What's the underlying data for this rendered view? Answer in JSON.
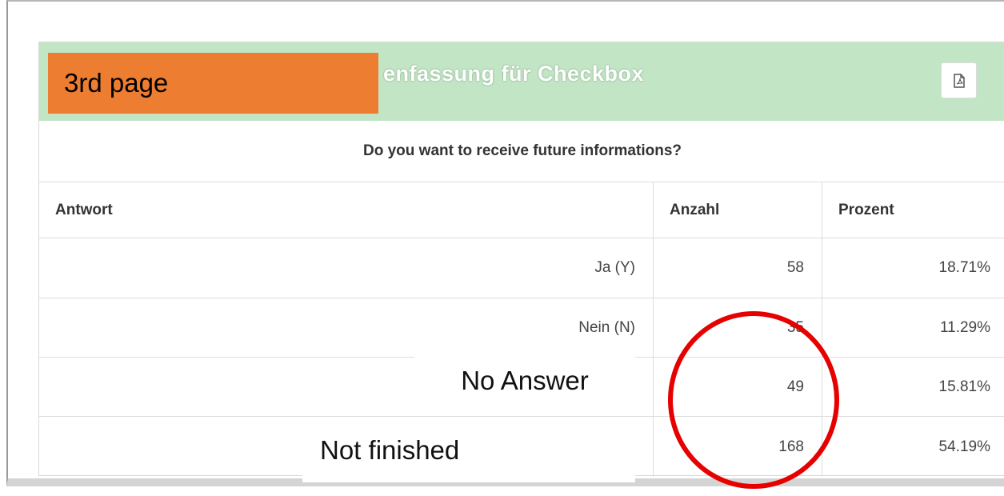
{
  "panel": {
    "title": "enfassung für Checkbox",
    "pdf_icon": "pdf-file-icon",
    "question": "Do you want to receive future informations?"
  },
  "table": {
    "headers": [
      "Antwort",
      "Anzahl",
      "Prozent"
    ],
    "rows": [
      {
        "answer": "Ja (Y)",
        "count": "58",
        "percent": "18.71%"
      },
      {
        "answer": "Nein (N)",
        "count": "35",
        "percent": "11.29%"
      },
      {
        "answer": "",
        "count": "49",
        "percent": "15.81%"
      },
      {
        "answer": "",
        "count": "168",
        "percent": "54.19%"
      }
    ]
  },
  "annotations": {
    "page_label": "3rd page",
    "no_answer": "No Answer",
    "not_finished": "Not finished",
    "label_color": "#ed7d31",
    "circle_color": "#e60000"
  }
}
